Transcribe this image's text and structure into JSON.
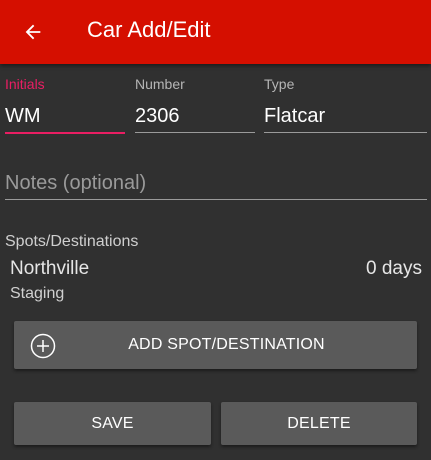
{
  "header": {
    "title": "Car Add/Edit",
    "back_icon": "arrow-back-icon"
  },
  "form": {
    "initials": {
      "label": "Initials",
      "value": "WM"
    },
    "number": {
      "label": "Number",
      "value": "2306"
    },
    "type": {
      "label": "Type",
      "value": "Flatcar"
    },
    "notes": {
      "placeholder": "Notes (optional)",
      "value": ""
    }
  },
  "spots": {
    "section_label": "Spots/Destinations",
    "items": [
      {
        "name": "Northville",
        "days": "0 days",
        "track": "Staging"
      }
    ]
  },
  "buttons": {
    "add_spot": "ADD SPOT/DESTINATION",
    "add_icon": "add-circle-outline-icon",
    "save": "SAVE",
    "delete": "DELETE"
  },
  "colors": {
    "appbar": "#d50f00",
    "background": "#303030",
    "accent": "#e91e63",
    "button": "#5a5a5a"
  }
}
